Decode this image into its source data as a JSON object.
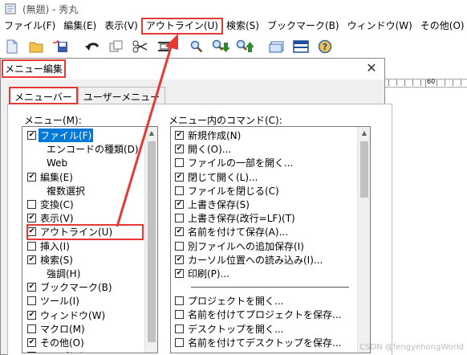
{
  "window": {
    "title": "(無題) - 秀丸"
  },
  "menubar": [
    {
      "label": "ファイル(F)",
      "highlighted": false
    },
    {
      "label": "編集(E)",
      "highlighted": false
    },
    {
      "label": "表示(V)",
      "highlighted": false
    },
    {
      "label": "アウトライン(U)",
      "highlighted": true
    },
    {
      "label": "検索(S)",
      "highlighted": false
    },
    {
      "label": "ブックマーク(B)",
      "highlighted": false
    },
    {
      "label": "ウィンドウ(W)",
      "highlighted": false
    },
    {
      "label": "その他(O)",
      "highlighted": false
    }
  ],
  "toolbar": {
    "icons": [
      "new-file-icon",
      "open-folder-icon",
      "save-icon",
      "undo-icon",
      "copy-icon",
      "cut-icon",
      "paste-icon",
      "search-icon",
      "search-down-icon",
      "search-up-icon",
      "window-icon",
      "split-window-icon",
      "help-icon"
    ]
  },
  "ruler": {
    "label": "60"
  },
  "dialog": {
    "title": "メニュー編集",
    "close": "✕",
    "tabs": [
      {
        "label": "メニューバー",
        "active": true
      },
      {
        "label": "ユーザーメニュー",
        "active": false
      }
    ],
    "menu_list": {
      "label": "メニュー(M):",
      "items": [
        {
          "label": "ファイル(F)",
          "checkbox": true,
          "checked": true,
          "indent": 0,
          "selected": true
        },
        {
          "label": "エンコードの種類(D)",
          "checkbox": false,
          "indent": 1
        },
        {
          "label": "Web",
          "checkbox": false,
          "indent": 1
        },
        {
          "label": "編集(E)",
          "checkbox": true,
          "checked": true,
          "indent": 0
        },
        {
          "label": "複数選択",
          "checkbox": false,
          "indent": 1
        },
        {
          "label": "変換(C)",
          "checkbox": true,
          "checked": false,
          "indent": 0
        },
        {
          "label": "表示(V)",
          "checkbox": true,
          "checked": true,
          "indent": 0
        },
        {
          "label": "アウトライン(U)",
          "checkbox": true,
          "checked": true,
          "indent": 0,
          "highlighted": true
        },
        {
          "label": "挿入(I)",
          "checkbox": true,
          "checked": false,
          "indent": 0
        },
        {
          "label": "検索(S)",
          "checkbox": true,
          "checked": true,
          "indent": 0
        },
        {
          "label": "強調(H)",
          "checkbox": false,
          "indent": 1
        },
        {
          "label": "ブックマーク(B)",
          "checkbox": true,
          "checked": true,
          "indent": 0
        },
        {
          "label": "ツール(I)",
          "checkbox": true,
          "checked": false,
          "indent": 0
        },
        {
          "label": "ウィンドウ(W)",
          "checkbox": true,
          "checked": true,
          "indent": 0
        },
        {
          "label": "マクロ(M)",
          "checkbox": true,
          "checked": false,
          "indent": 0
        },
        {
          "label": "その他(O)",
          "checkbox": true,
          "checked": true,
          "indent": 0
        },
        {
          "label": "ヘルプ(H)",
          "checkbox": true,
          "checked": false,
          "indent": 0
        }
      ]
    },
    "command_list": {
      "label": "メニュー内のコマンド(C):",
      "items": [
        {
          "label": "新規作成(N)",
          "checked": true
        },
        {
          "label": "開く(O)...",
          "checked": true
        },
        {
          "label": "ファイルの一部を開く...",
          "checked": false
        },
        {
          "label": "閉じて開く(L)...",
          "checked": true
        },
        {
          "label": "ファイルを閉じる(C)",
          "checked": false
        },
        {
          "label": "上書き保存(S)",
          "checked": true
        },
        {
          "label": "上書き保存(改行=LF)(T)",
          "checked": false
        },
        {
          "label": "名前を付けて保存(A)...",
          "checked": true
        },
        {
          "label": "別ファイルへの追加保存(I)",
          "checked": false
        },
        {
          "label": "カーソル位置への読み込み(I)...",
          "checked": true
        },
        {
          "label": "印刷(P)...",
          "checked": true
        },
        {
          "divider": true
        },
        {
          "label": "プロジェクトを開く...",
          "checked": false
        },
        {
          "label": "名前を付けてプロジェクトを保存...",
          "checked": false
        },
        {
          "label": "デスクトップを開く...",
          "checked": false
        },
        {
          "label": "名前を付けてデスクトップを保存...",
          "checked": false
        }
      ]
    }
  },
  "watermark": "CSDN @fengyehongWorld",
  "colors": {
    "highlight": "#e53935",
    "selection": "#0078d7"
  }
}
